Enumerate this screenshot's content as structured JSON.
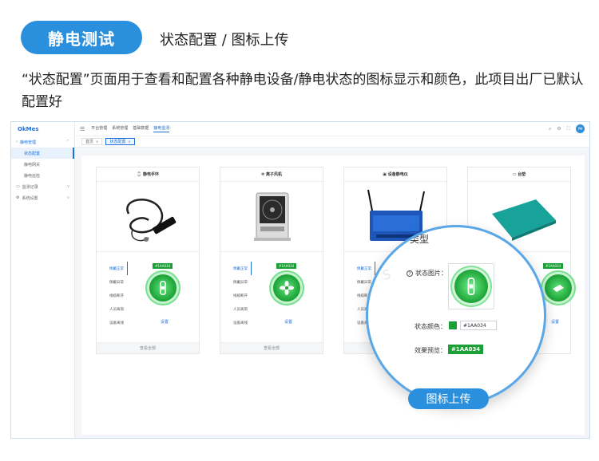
{
  "header": {
    "pill_title": "静电测试",
    "subtitle": "状态配置 / 图标上传",
    "description": "“状态配置”页面用于查看和配置各种静电设备/静电状态的图标显示和颜色，此项目出厂已默认配置好"
  },
  "app": {
    "logo": "OkMes",
    "sidebar": {
      "group_static": "静电管理",
      "items": [
        "状态配置",
        "静电网关",
        "静电巡检"
      ],
      "group_monitor": "监测记录",
      "group_system": "系统设置"
    },
    "topbar": {
      "nav": [
        "平台管理",
        "系统管理",
        "基础数据",
        "静电监测"
      ],
      "avatar": "PM"
    },
    "tabs": [
      {
        "label": "首页"
      },
      {
        "label": "状态配置"
      }
    ],
    "cards": [
      {
        "title": "静电手环",
        "states": [
          "佩戴正常",
          "佩戴异常",
          "线缆断开",
          "人员离岗",
          "设备离线"
        ],
        "badge": "#1AA034",
        "set_label": "设置",
        "footer": "查看全部"
      },
      {
        "title": "离子风机",
        "states": [
          "佩戴正常",
          "佩戴异常",
          "线缆断开",
          "人员离岗",
          "设备离线"
        ],
        "badge": "#1AA034",
        "set_label": "设置",
        "footer": "查看全部"
      },
      {
        "title": "设备静电仪",
        "states": [
          "佩戴正常",
          "佩戴异常",
          "线缆断开",
          "人员离岗",
          "设备离线"
        ],
        "badge": "#1AA034",
        "set_label": "设置",
        "footer": "查看全部"
      },
      {
        "title": "台垫",
        "states": [],
        "badge": "#1AA034",
        "set_label": "设置",
        "footer": ""
      }
    ]
  },
  "magnifier": {
    "partial_title": "类型",
    "image_label": "状态图片：",
    "color_label": "状态颜色：",
    "color_value": "#1AA034",
    "preview_label": "效果预览：",
    "preview_value": "#1AA034"
  },
  "colors": {
    "accent": "#2a8fdd",
    "status_green": "#1AA034"
  },
  "bottom_label": "图标上传"
}
